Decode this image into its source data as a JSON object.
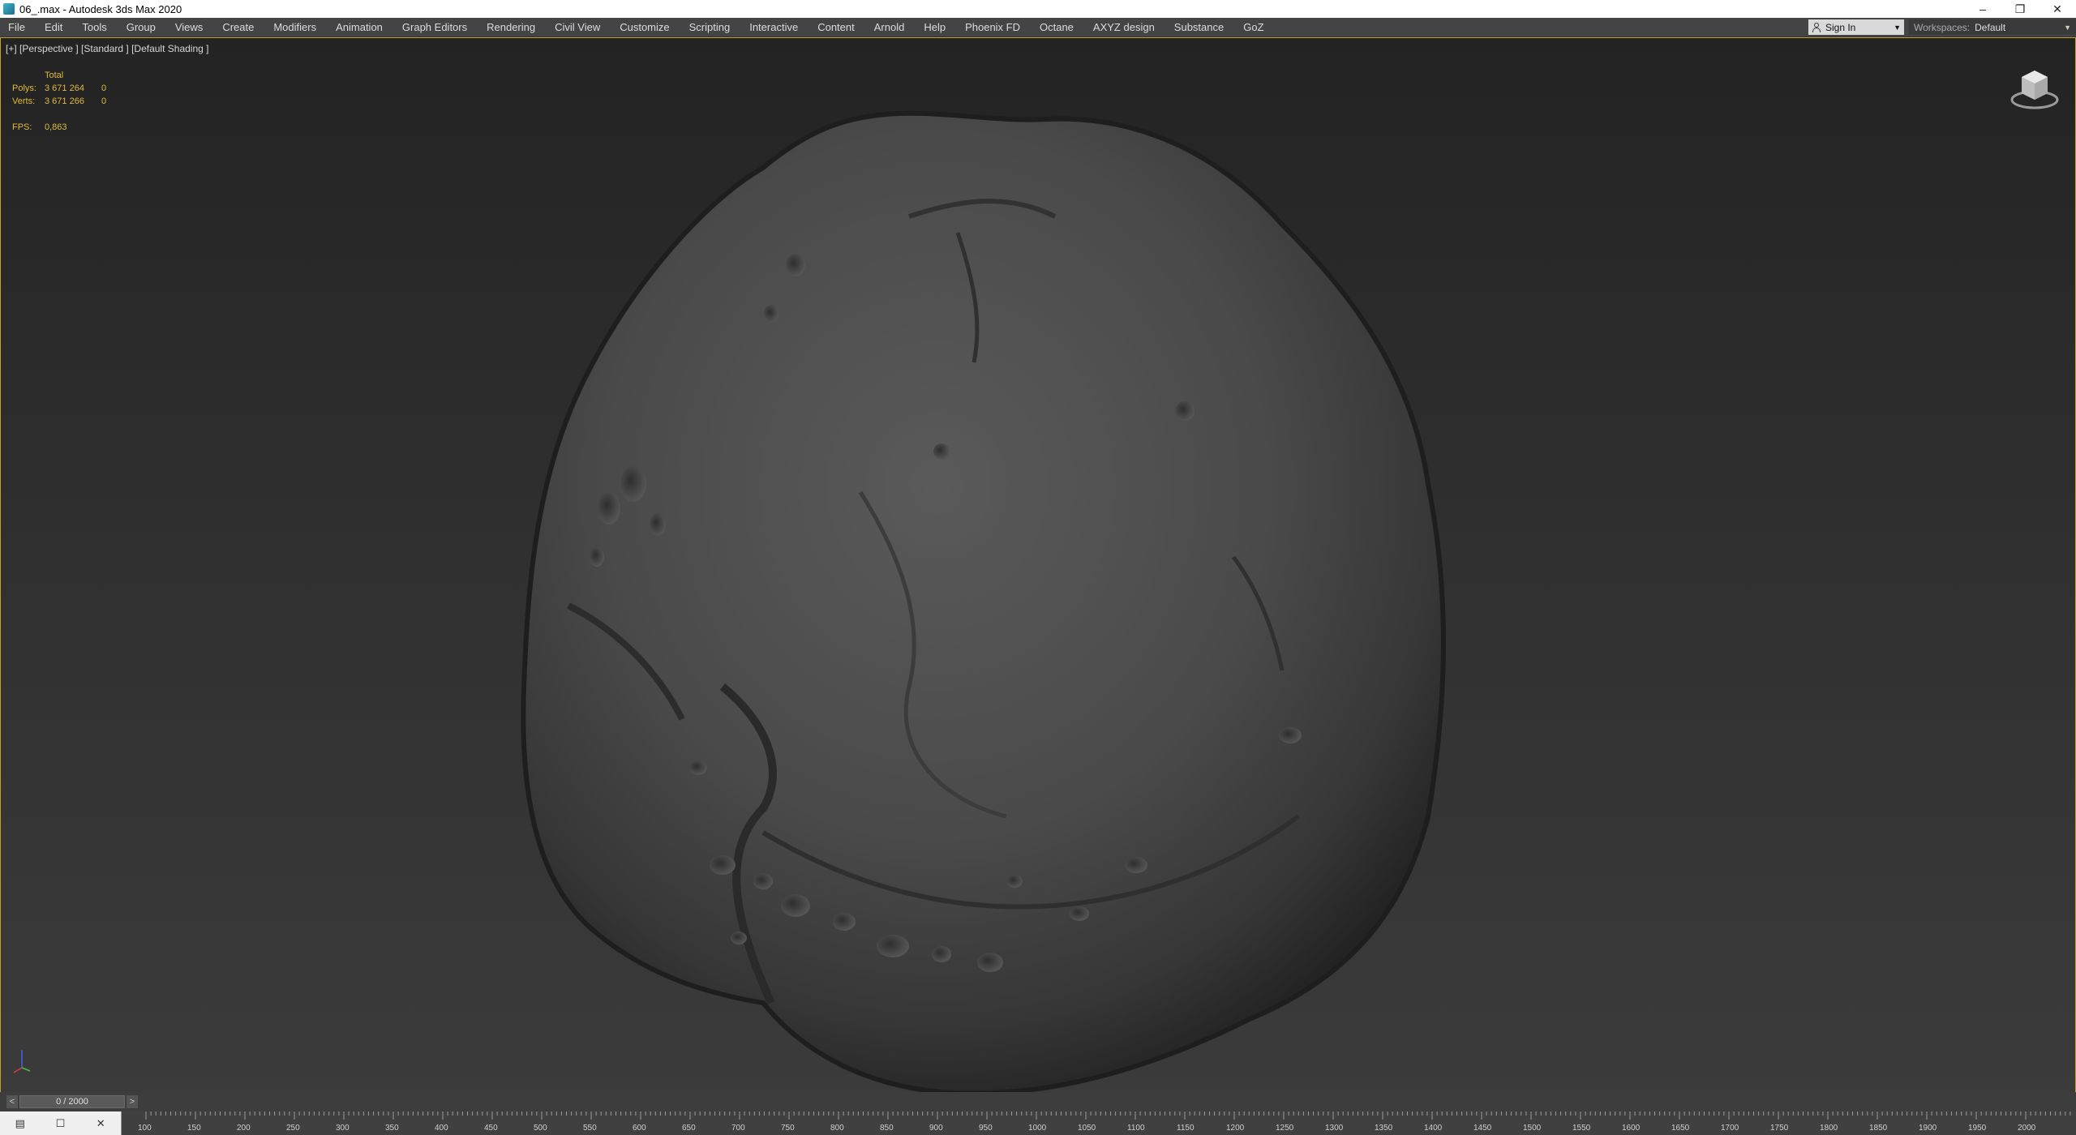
{
  "window": {
    "title": "06_.max - Autodesk 3ds Max 2020",
    "icon": "3ds-max-app-icon",
    "minimize": "–",
    "restore": "❐",
    "close": "✕"
  },
  "menu": {
    "items": [
      "File",
      "Edit",
      "Tools",
      "Group",
      "Views",
      "Create",
      "Modifiers",
      "Animation",
      "Graph Editors",
      "Rendering",
      "Civil View",
      "Customize",
      "Scripting",
      "Interactive",
      "Content",
      "Arnold",
      "Help",
      "Phoenix FD",
      "Octane",
      "AXYZ design",
      "Substance",
      "GoZ"
    ],
    "sign_in": "Sign In",
    "workspaces_label": "Workspaces:",
    "workspaces_value": "Default"
  },
  "viewport": {
    "label": "[+] [Perspective ] [Standard ] [Default Shading ]",
    "stats": {
      "header": "Total",
      "polys_label": "Polys:",
      "polys_total": "3 671 264",
      "polys_sel": "0",
      "verts_label": "Verts:",
      "verts_total": "3 671 266",
      "verts_sel": "0",
      "fps_label": "FPS:",
      "fps_value": "0,863"
    },
    "accent_color": "#c8a028"
  },
  "timeline": {
    "prev": "<",
    "frame": "0 / 2000",
    "next": ">",
    "ticks": [
      "100",
      "150",
      "200",
      "250",
      "300",
      "350",
      "400",
      "450",
      "500",
      "550",
      "600",
      "650",
      "700",
      "750",
      "800",
      "850",
      "900",
      "950",
      "1000",
      "1050",
      "1100",
      "1150",
      "1200",
      "1250",
      "1300",
      "1350",
      "1400",
      "1450",
      "1500",
      "1550",
      "1600",
      "1650",
      "1700",
      "1750",
      "1800",
      "1850",
      "1900",
      "1950",
      "2000"
    ]
  },
  "mini_listener": {
    "icon_a": "listener-icon",
    "icon_b": "maximize-icon",
    "icon_c": "close-icon"
  }
}
